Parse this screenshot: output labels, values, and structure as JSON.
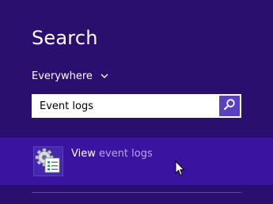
{
  "search": {
    "title": "Search",
    "scope_label": "Everywhere",
    "query": "Event logs"
  },
  "result": {
    "prefix": "View",
    "suffix": "event logs",
    "icon": "event-viewer-gear-icon"
  },
  "icons": {
    "scope_toggle": "chevron-down-icon",
    "search_button": "magnifier-icon",
    "pointer": "mouse-cursor-icon"
  },
  "colors": {
    "background": "#2a0f6e",
    "highlight_row": "#3a13a0",
    "search_button": "#5a3fc0",
    "dim_text": "#b9a9ee"
  }
}
